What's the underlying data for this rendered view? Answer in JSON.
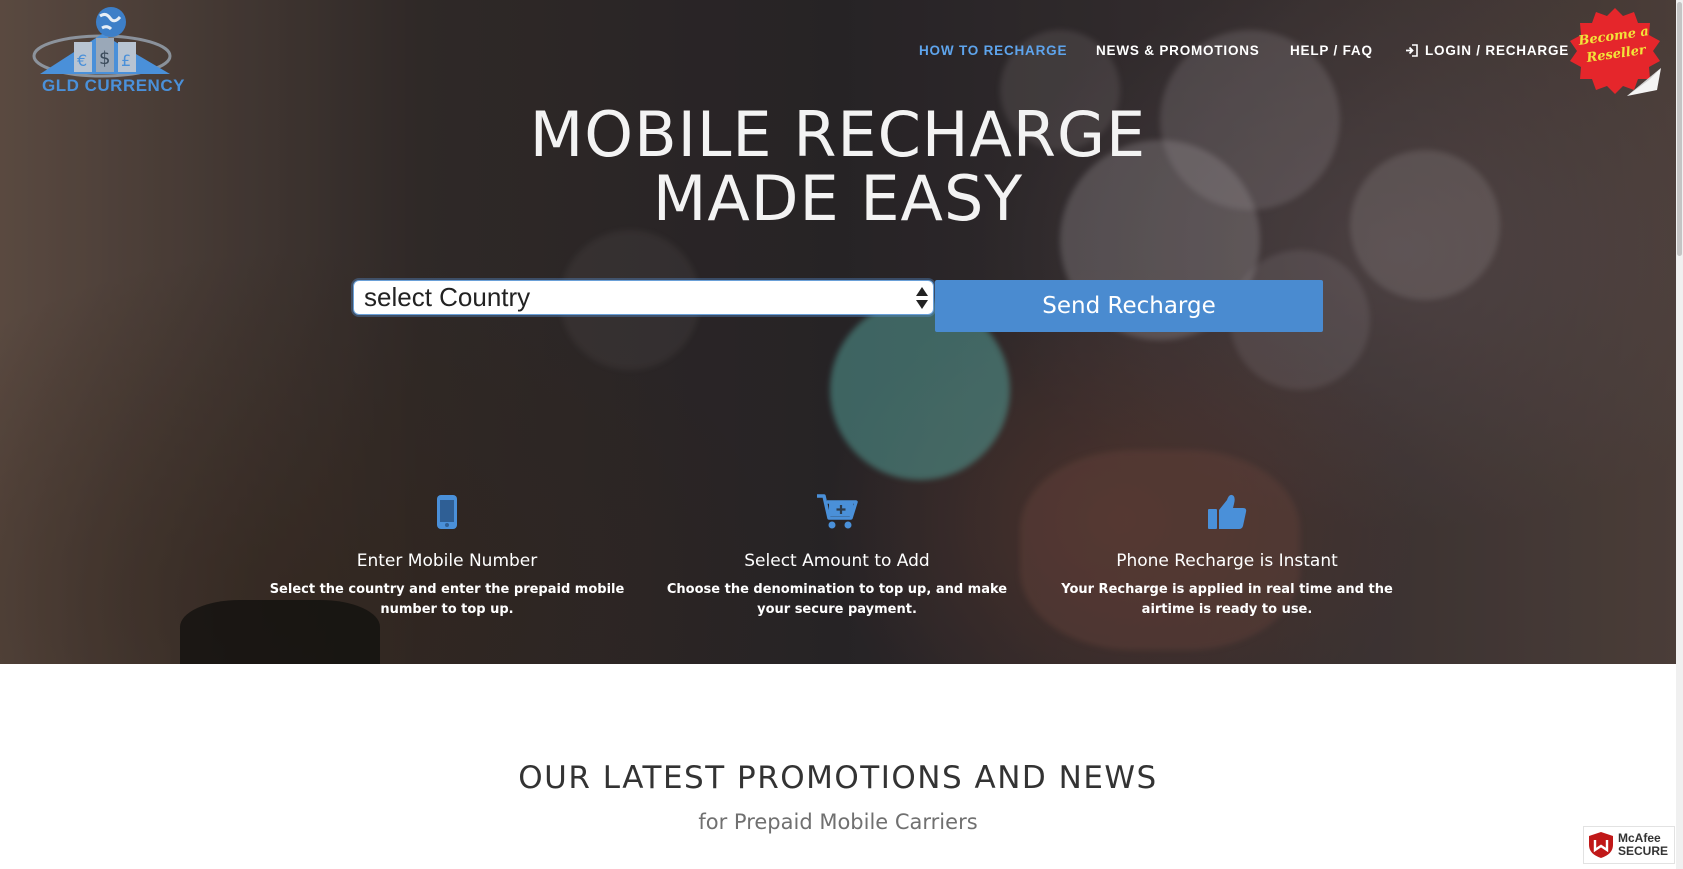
{
  "logo": {
    "text": "GLD CURRENCY",
    "icon": "globe-currency-logo"
  },
  "nav": {
    "items": [
      {
        "label": "HOW TO RECHARGE",
        "active": true
      },
      {
        "label": "NEWS & PROMOTIONS",
        "active": false
      },
      {
        "label": "HELP / FAQ",
        "active": false
      },
      {
        "label": "LOGIN / RECHARGE",
        "active": false,
        "icon": "sign-in-icon"
      }
    ],
    "active_color": "#5ea4ec"
  },
  "badge": {
    "line1": "Become a",
    "line2": "Reseller",
    "color": "#e5262b",
    "text_color": "#f2e33a"
  },
  "hero": {
    "headline_line1": "MOBILE RECHARGE",
    "headline_line2": "MADE EASY"
  },
  "form": {
    "country_select": {
      "value": "select Country"
    },
    "send_button": "Send Recharge",
    "button_color": "#4a8bd0"
  },
  "features": [
    {
      "icon": "mobile-phone-icon",
      "title": "Enter Mobile Number",
      "description": "Select the country and enter the prepaid mobile number to top up."
    },
    {
      "icon": "shopping-cart-plus-icon",
      "title": "Select Amount to Add",
      "description": "Choose the denomination to top up, and make your secure payment."
    },
    {
      "icon": "thumbs-up-icon",
      "title": "Phone Recharge is Instant",
      "description": "Your Recharge is applied in real time and the airtime is ready to use."
    }
  ],
  "promotions": {
    "title": "OUR LATEST PROMOTIONS AND NEWS",
    "subtitle": "for Prepaid Mobile Carriers"
  },
  "mcafee": {
    "line1": "McAfee",
    "line2": "SECURE"
  }
}
